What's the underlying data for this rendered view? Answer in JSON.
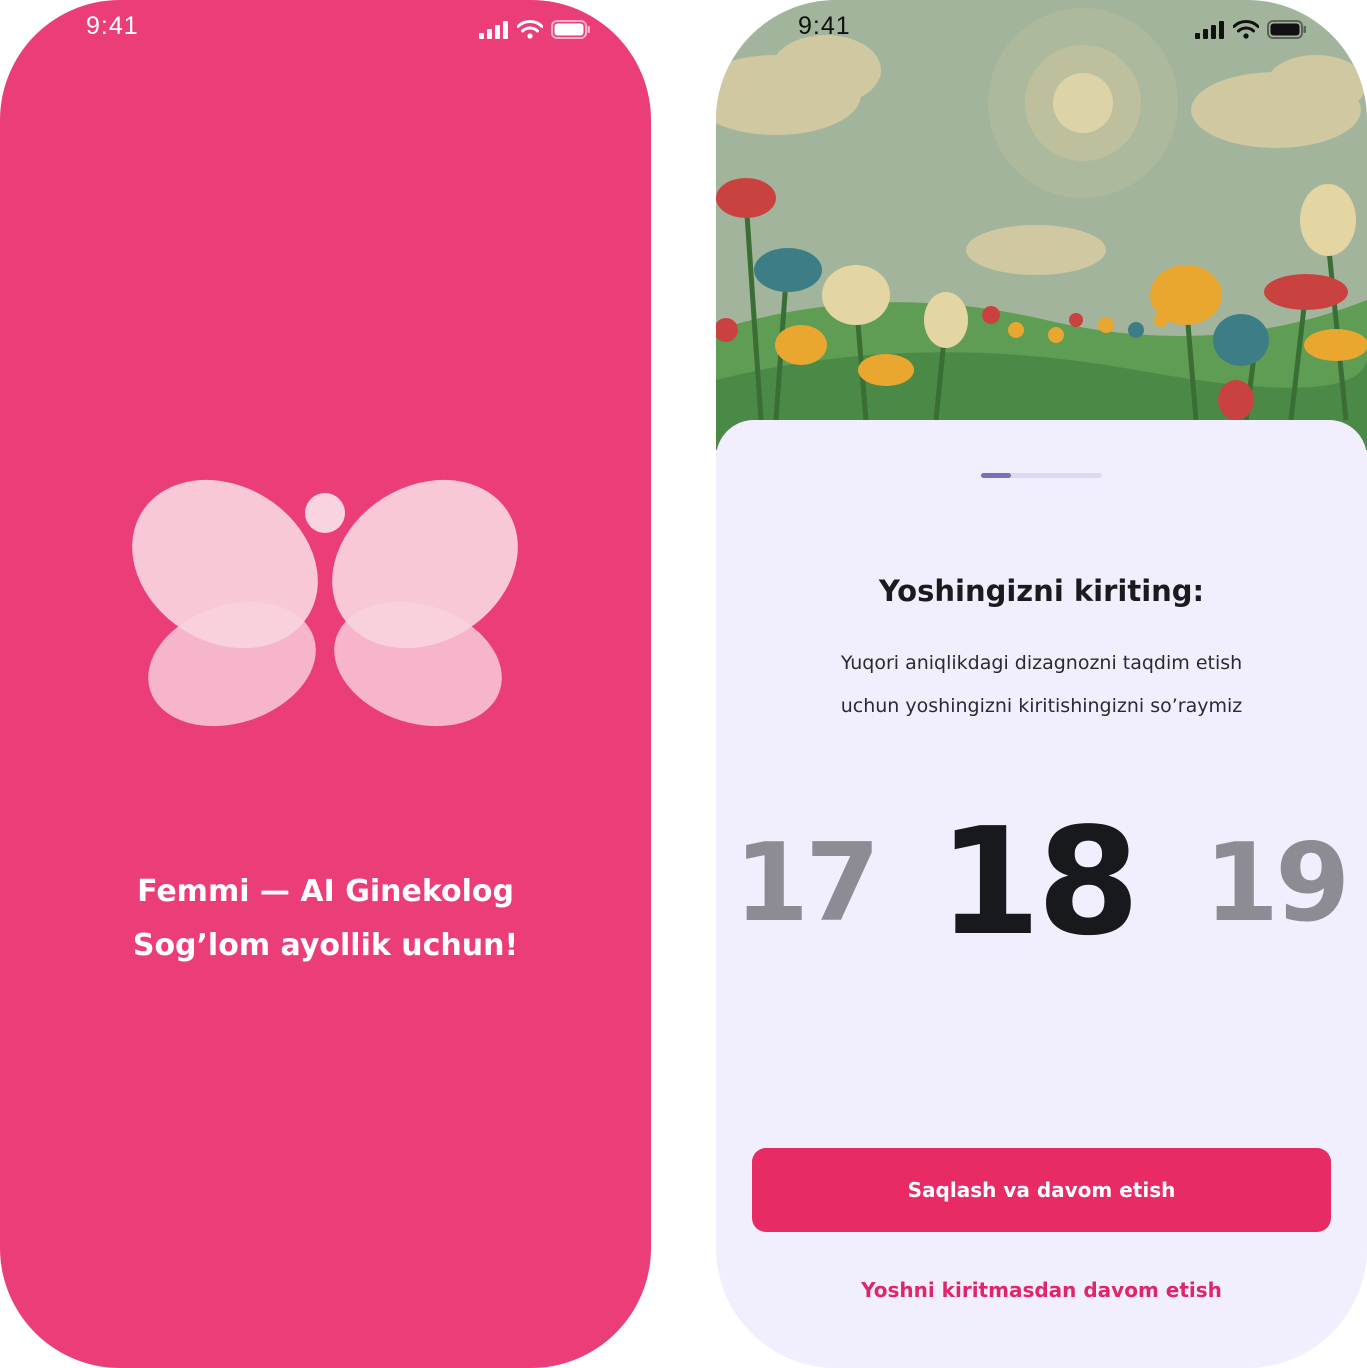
{
  "splash": {
    "status_time": "9:41",
    "title": "Femmi — AI Ginekolog",
    "subtitle": "Sog’lom ayollik uchun!",
    "colors": {
      "background": "#eb3e78",
      "logo": "#f9d3df"
    },
    "logo_icon": "butterfly-logo-icon"
  },
  "age_screen": {
    "status_time": "9:41",
    "progress": 0.25,
    "title": "Yoshingizni kiriting:",
    "description_line1": "Yuqori aniqlikdagi dizagnozni taqdim etish",
    "description_line2": "uchun yoshingizni kiritishingizni so’raymiz",
    "age_picker": {
      "previous": "17",
      "selected": "18",
      "next": "19"
    },
    "save_button_label": "Saqlash va davom etish",
    "skip_link_label": "Yoshni kiritmasdan davom etish",
    "colors": {
      "primary": "#e82a65",
      "sheet": "#f1effd",
      "progress": "#7b6fb8"
    },
    "hero_image": "flower-meadow-illustration"
  }
}
